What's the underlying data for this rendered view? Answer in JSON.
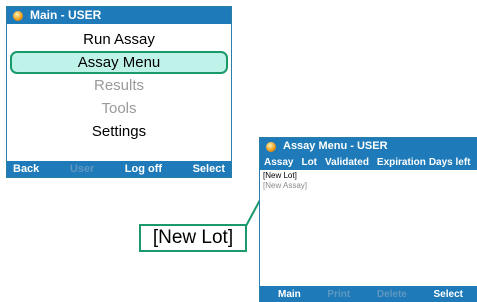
{
  "screen1": {
    "title": "Main - USER",
    "menu": [
      {
        "label": "Run Assay",
        "state": "normal"
      },
      {
        "label": "Assay Menu",
        "state": "selected"
      },
      {
        "label": "Results",
        "state": "disabled"
      },
      {
        "label": "Tools",
        "state": "disabled"
      },
      {
        "label": "Settings",
        "state": "normal"
      }
    ],
    "softkeys": {
      "back": "Back",
      "user": "User",
      "logoff": "Log off",
      "select": "Select"
    }
  },
  "screen2": {
    "title": "Assay Menu - USER",
    "columns": [
      "Assay",
      "Lot",
      "Validated",
      "Expiration",
      "Days left"
    ],
    "rows": [
      "[New Lot]",
      "[New Assay]"
    ],
    "softkeys": {
      "main": "Main",
      "print": "Print",
      "delete": "Delete",
      "select": "Select"
    }
  },
  "callout": {
    "label": "[New Lot]"
  },
  "colors": {
    "titlebar": "#1e7ab8",
    "highlight": "#bff3ea",
    "highlight_border": "#1a9a6a"
  },
  "icons": {
    "title_icon": "app-logo-icon"
  }
}
